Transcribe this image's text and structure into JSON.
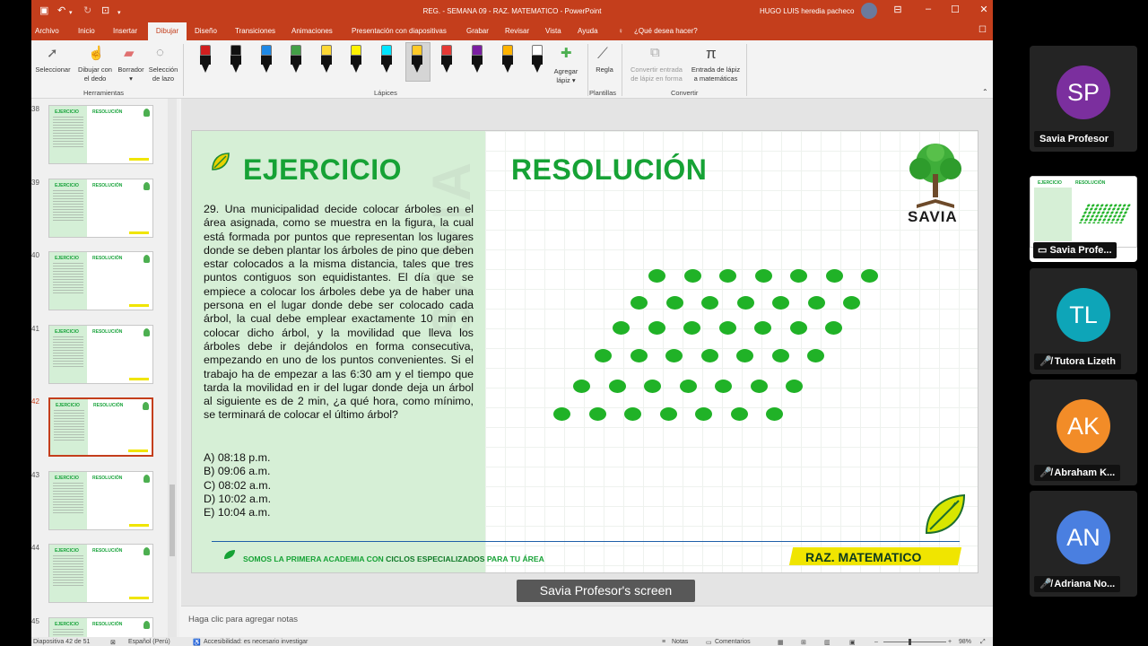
{
  "titlebar": {
    "document_title": "REG. - SEMANA 09 - RAZ. MATEMATICO  -  PowerPoint",
    "user_name": "HUGO LUIS heredia pacheco"
  },
  "menu": {
    "tabs": [
      "Archivo",
      "Inicio",
      "Insertar",
      "Dibujar",
      "Diseño",
      "Transiciones",
      "Animaciones",
      "Presentación con diapositivas",
      "Grabar",
      "Revisar",
      "Vista",
      "Ayuda"
    ],
    "tell_me": "¿Qué desea hacer?"
  },
  "ribbon": {
    "tools": {
      "select": "Seleccionar",
      "draw_finger_1": "Dibujar con",
      "draw_finger_2": "el dedo",
      "eraser": "Borrador",
      "lasso_1": "Selección",
      "lasso_2": "de lazo"
    },
    "tools_group": "Herramientas",
    "pens_group": "Lápices",
    "add_pen_1": "Agregar",
    "add_pen_2": "lápiz",
    "ruler": "Regla",
    "stencils_group": "Plantillas",
    "ink_to_shape_1": "Convertir entrada",
    "ink_to_shape_2": "de lápiz en forma",
    "ink_to_math_1": "Entrada de lápiz",
    "ink_to_math_2": "a matemáticas",
    "convert_group": "Convertir",
    "pen_colors": [
      "#d11f1f",
      "#111111",
      "#1e88e5",
      "#43a047",
      "#fdd835",
      "#fff200",
      "#00e5ff",
      "#ffca28",
      "#e53935",
      "#7b1fa2",
      "#ffb300",
      "#ffffff"
    ]
  },
  "thumbnails": {
    "numbers": [
      "38",
      "39",
      "40",
      "41",
      "42",
      "43",
      "44",
      "45"
    ],
    "label_left": "EJERCICIO",
    "label_right": "RESOLUCIÓN",
    "selected": "42"
  },
  "slide": {
    "left_title": "EJERCICIO",
    "right_title": "RESOLUCIÓN",
    "problem": "29. Una municipalidad decide colocar árboles en el área asignada, como se muestra en la figura, la cual está formada por puntos que representan los lugares donde se deben plantar los árboles de pino que deben estar colocados a la misma distancia, tales que tres puntos contiguos son equidistantes. El día que se empiece a colocar los árboles debe ya de haber una persona en el lugar donde debe ser colocado cada árbol, la cual debe emplear exactamente 10 min en colocar dicho árbol, y la movilidad que lleva los árboles debe ir dejándolos en forma consecutiva, empezando en uno de los puntos convenientes. Si el trabajo ha de empezar a las 6:30 am y el tiempo que tarda la movilidad en ir del lugar donde deja un árbol al siguiente es de 2 min, ¿a qué hora, como mínimo, se terminará de colocar el último árbol?",
    "options": [
      "A) 08:18 p.m.",
      "B) 09:06 a.m.",
      "C) 08:02 a.m.",
      "D) 10:02 a.m.",
      "E) 10:04 a.m."
    ],
    "logo_text": "SAVIA",
    "watermark": "SAVIA",
    "footer_pre": "SOMOS LA PRIMERA ACADEMIA CON ",
    "footer_strong": "CICLOS ESPECIALIZADOS",
    "footer_post": " PARA TU ÁREA",
    "badge": "RAZ. MATEMATICO",
    "dot_color": "#20b227",
    "dot_rows": [
      7,
      7,
      7,
      7,
      7,
      7
    ]
  },
  "screen_share_label": "Savia Profesor's screen",
  "notes_placeholder": "Haga clic para agregar notas",
  "status": {
    "slide": "Diapositiva 42 de 51",
    "language": "Español (Perú)",
    "accessibility": "Accesibilidad: es necesario investigar",
    "notes": "Notas",
    "comments": "Comentarios",
    "zoom": "98%"
  },
  "participants": [
    {
      "initials": "SP",
      "name": "Savia Profesor",
      "color": "#7b2f9e",
      "muted": false
    },
    {
      "initials": "",
      "name": "Savia Profe...",
      "color": "#ffffff",
      "muted": false,
      "sharing": true
    },
    {
      "initials": "TL",
      "name": "Tutora Lizeth",
      "color": "#0ea5b8",
      "muted": true
    },
    {
      "initials": "AK",
      "name": "Abraham K...",
      "color": "#f28c28",
      "muted": true
    },
    {
      "initials": "AN",
      "name": "Adriana No...",
      "color": "#4a7fe0",
      "muted": true
    }
  ]
}
